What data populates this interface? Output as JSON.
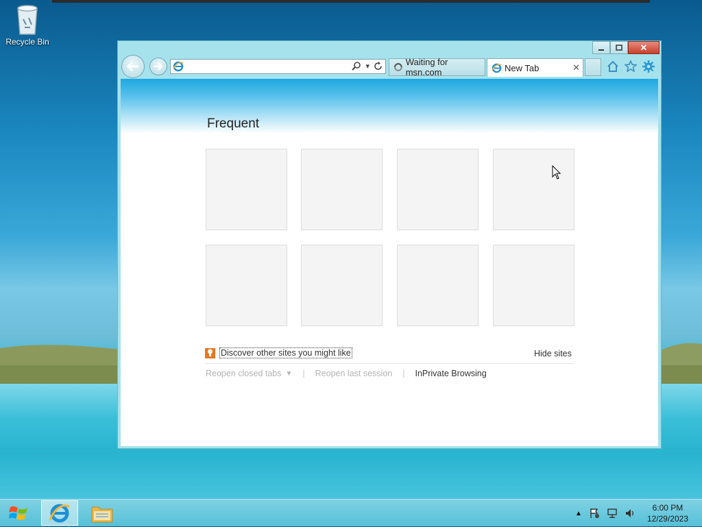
{
  "desktop": {
    "icons": [
      {
        "label": "Recycle Bin",
        "icon": "recycle-bin-icon"
      }
    ]
  },
  "browser": {
    "address": {
      "value": "",
      "placeholder": ""
    },
    "tabs": [
      {
        "label": "Waiting for msn.com",
        "icon": "loading-icon",
        "active": false
      },
      {
        "label": "New Tab",
        "icon": "ie-icon",
        "active": true
      }
    ],
    "toolbar_icons": [
      "home-icon",
      "favorites-star-icon",
      "settings-gear-icon"
    ],
    "newtab": {
      "heading": "Frequent",
      "tile_count": 8,
      "discover_label": "Discover other sites you might like",
      "hide_sites_label": "Hide sites",
      "links": {
        "reopen_closed": "Reopen closed tabs",
        "reopen_last": "Reopen last session",
        "inprivate": "InPrivate Browsing"
      }
    }
  },
  "taskbar": {
    "apps": [
      "internet-explorer",
      "file-explorer"
    ],
    "clock": {
      "time": "6:00 PM",
      "date": "12/29/2023"
    }
  },
  "colors": {
    "accent": "#1ea7e0",
    "discover_badge": "#e87722",
    "close_button": "#c7402d"
  }
}
